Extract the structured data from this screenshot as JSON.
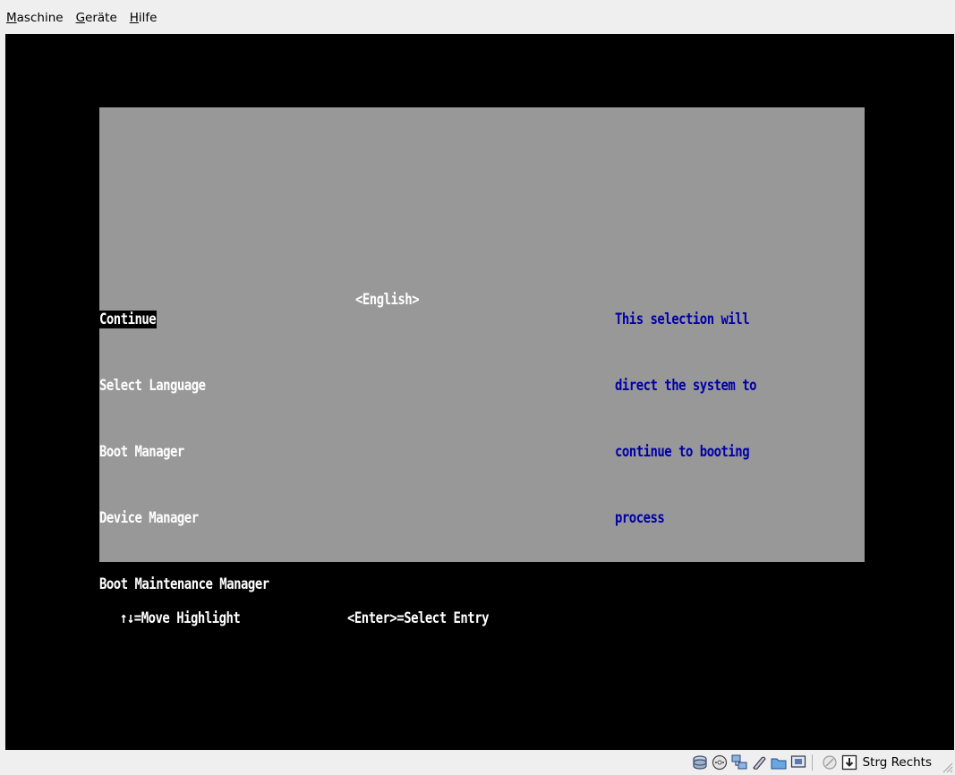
{
  "menubar": {
    "items": [
      {
        "mnemonic": "M",
        "rest": "aschine"
      },
      {
        "mnemonic": "G",
        "rest": "eräte"
      },
      {
        "mnemonic": "H",
        "rest": "ilfe"
      }
    ]
  },
  "setup": {
    "menu": [
      {
        "label": "Continue",
        "selected": true
      },
      {
        "label": "Select Language",
        "selected": false
      },
      {
        "label": "Boot Manager",
        "selected": false
      },
      {
        "label": "Device Manager",
        "selected": false
      },
      {
        "label": "Boot Maintenance Manager",
        "selected": false
      }
    ],
    "language_value": "<English>",
    "help_lines": [
      "This selection will",
      "direct the system to",
      "continue to booting",
      "process"
    ],
    "footer": {
      "move": "↑↓=Move Highlight",
      "select": "<Enter>=Select Entry"
    }
  },
  "statusbar": {
    "icons": [
      "hard-disk-icon",
      "optical-drive-icon",
      "network-icon",
      "usb-icon",
      "shared-folder-icon",
      "display-icon",
      "mouse-integration-icon",
      "keyboard-capture-icon"
    ],
    "host_key": "Strg Rechts"
  },
  "colors": {
    "panel": "#989898",
    "screen": "#000000",
    "help_text": "#0000a8",
    "chrome": "#efefef"
  }
}
